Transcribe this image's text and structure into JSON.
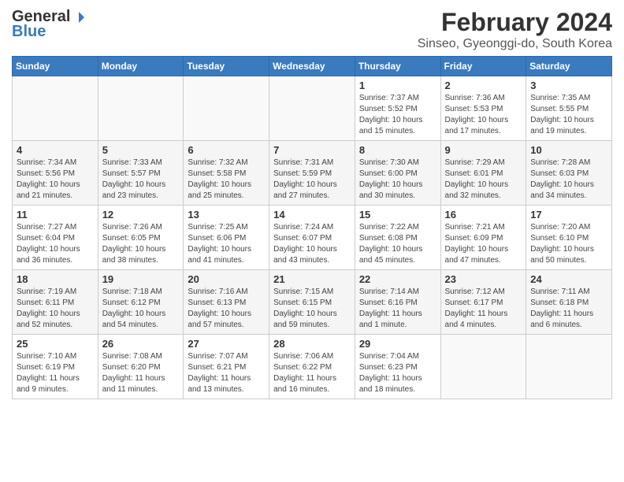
{
  "logo": {
    "general": "General",
    "blue": "Blue"
  },
  "title": {
    "month_year": "February 2024",
    "location": "Sinseo, Gyeonggi-do, South Korea"
  },
  "days_of_week": [
    "Sunday",
    "Monday",
    "Tuesday",
    "Wednesday",
    "Thursday",
    "Friday",
    "Saturday"
  ],
  "weeks": [
    [
      {
        "day": "",
        "info": ""
      },
      {
        "day": "",
        "info": ""
      },
      {
        "day": "",
        "info": ""
      },
      {
        "day": "",
        "info": ""
      },
      {
        "day": "1",
        "info": "Sunrise: 7:37 AM\nSunset: 5:52 PM\nDaylight: 10 hours\nand 15 minutes."
      },
      {
        "day": "2",
        "info": "Sunrise: 7:36 AM\nSunset: 5:53 PM\nDaylight: 10 hours\nand 17 minutes."
      },
      {
        "day": "3",
        "info": "Sunrise: 7:35 AM\nSunset: 5:55 PM\nDaylight: 10 hours\nand 19 minutes."
      }
    ],
    [
      {
        "day": "4",
        "info": "Sunrise: 7:34 AM\nSunset: 5:56 PM\nDaylight: 10 hours\nand 21 minutes."
      },
      {
        "day": "5",
        "info": "Sunrise: 7:33 AM\nSunset: 5:57 PM\nDaylight: 10 hours\nand 23 minutes."
      },
      {
        "day": "6",
        "info": "Sunrise: 7:32 AM\nSunset: 5:58 PM\nDaylight: 10 hours\nand 25 minutes."
      },
      {
        "day": "7",
        "info": "Sunrise: 7:31 AM\nSunset: 5:59 PM\nDaylight: 10 hours\nand 27 minutes."
      },
      {
        "day": "8",
        "info": "Sunrise: 7:30 AM\nSunset: 6:00 PM\nDaylight: 10 hours\nand 30 minutes."
      },
      {
        "day": "9",
        "info": "Sunrise: 7:29 AM\nSunset: 6:01 PM\nDaylight: 10 hours\nand 32 minutes."
      },
      {
        "day": "10",
        "info": "Sunrise: 7:28 AM\nSunset: 6:03 PM\nDaylight: 10 hours\nand 34 minutes."
      }
    ],
    [
      {
        "day": "11",
        "info": "Sunrise: 7:27 AM\nSunset: 6:04 PM\nDaylight: 10 hours\nand 36 minutes."
      },
      {
        "day": "12",
        "info": "Sunrise: 7:26 AM\nSunset: 6:05 PM\nDaylight: 10 hours\nand 38 minutes."
      },
      {
        "day": "13",
        "info": "Sunrise: 7:25 AM\nSunset: 6:06 PM\nDaylight: 10 hours\nand 41 minutes."
      },
      {
        "day": "14",
        "info": "Sunrise: 7:24 AM\nSunset: 6:07 PM\nDaylight: 10 hours\nand 43 minutes."
      },
      {
        "day": "15",
        "info": "Sunrise: 7:22 AM\nSunset: 6:08 PM\nDaylight: 10 hours\nand 45 minutes."
      },
      {
        "day": "16",
        "info": "Sunrise: 7:21 AM\nSunset: 6:09 PM\nDaylight: 10 hours\nand 47 minutes."
      },
      {
        "day": "17",
        "info": "Sunrise: 7:20 AM\nSunset: 6:10 PM\nDaylight: 10 hours\nand 50 minutes."
      }
    ],
    [
      {
        "day": "18",
        "info": "Sunrise: 7:19 AM\nSunset: 6:11 PM\nDaylight: 10 hours\nand 52 minutes."
      },
      {
        "day": "19",
        "info": "Sunrise: 7:18 AM\nSunset: 6:12 PM\nDaylight: 10 hours\nand 54 minutes."
      },
      {
        "day": "20",
        "info": "Sunrise: 7:16 AM\nSunset: 6:13 PM\nDaylight: 10 hours\nand 57 minutes."
      },
      {
        "day": "21",
        "info": "Sunrise: 7:15 AM\nSunset: 6:15 PM\nDaylight: 10 hours\nand 59 minutes."
      },
      {
        "day": "22",
        "info": "Sunrise: 7:14 AM\nSunset: 6:16 PM\nDaylight: 11 hours\nand 1 minute."
      },
      {
        "day": "23",
        "info": "Sunrise: 7:12 AM\nSunset: 6:17 PM\nDaylight: 11 hours\nand 4 minutes."
      },
      {
        "day": "24",
        "info": "Sunrise: 7:11 AM\nSunset: 6:18 PM\nDaylight: 11 hours\nand 6 minutes."
      }
    ],
    [
      {
        "day": "25",
        "info": "Sunrise: 7:10 AM\nSunset: 6:19 PM\nDaylight: 11 hours\nand 9 minutes."
      },
      {
        "day": "26",
        "info": "Sunrise: 7:08 AM\nSunset: 6:20 PM\nDaylight: 11 hours\nand 11 minutes."
      },
      {
        "day": "27",
        "info": "Sunrise: 7:07 AM\nSunset: 6:21 PM\nDaylight: 11 hours\nand 13 minutes."
      },
      {
        "day": "28",
        "info": "Sunrise: 7:06 AM\nSunset: 6:22 PM\nDaylight: 11 hours\nand 16 minutes."
      },
      {
        "day": "29",
        "info": "Sunrise: 7:04 AM\nSunset: 6:23 PM\nDaylight: 11 hours\nand 18 minutes."
      },
      {
        "day": "",
        "info": ""
      },
      {
        "day": "",
        "info": ""
      }
    ]
  ]
}
